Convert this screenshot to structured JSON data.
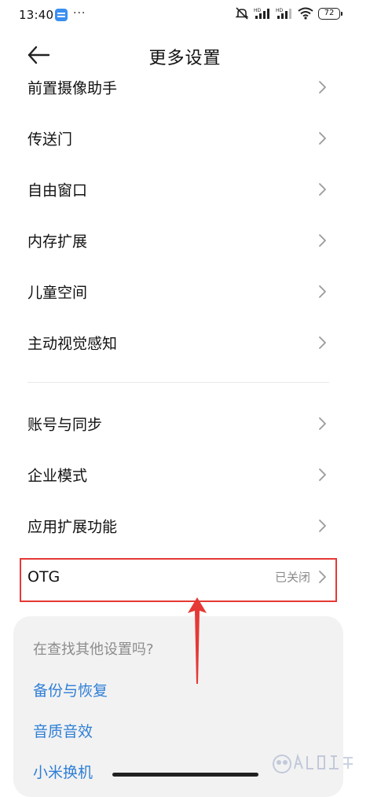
{
  "status_bar": {
    "time": "13:40",
    "more": "···",
    "battery": "72"
  },
  "header": {
    "title": "更多设置"
  },
  "group1": [
    {
      "label": "前置摄像助手"
    },
    {
      "label": "传送门"
    },
    {
      "label": "自由窗口"
    },
    {
      "label": "内存扩展"
    },
    {
      "label": "儿童空间"
    },
    {
      "label": "主动视觉感知"
    }
  ],
  "group2": [
    {
      "label": "账号与同步"
    },
    {
      "label": "企业模式"
    },
    {
      "label": "应用扩展功能"
    },
    {
      "label": "OTG",
      "value": "已关闭"
    }
  ],
  "suggestions": {
    "title": "在查找其他设置吗?",
    "links": [
      "备份与恢复",
      "音质音效",
      "小米换机"
    ]
  },
  "colors": {
    "accent_link": "#2f7fd6",
    "highlight": "#e53935"
  },
  "icons": {
    "back": "arrow-left-icon",
    "chevron": "chevron-right-icon"
  }
}
